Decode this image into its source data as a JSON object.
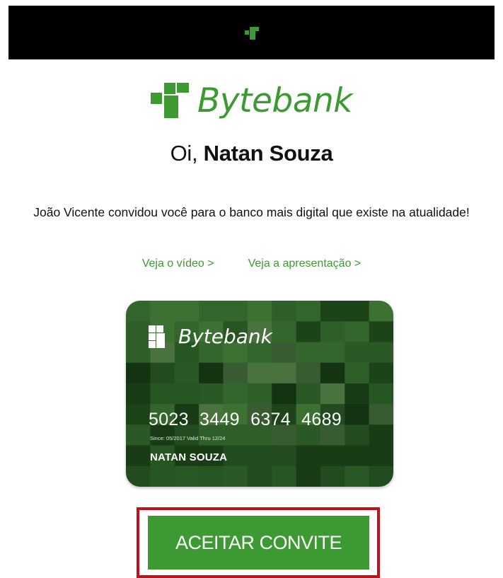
{
  "header": {
    "logo_icon": "bytebank-mark-icon"
  },
  "brand": {
    "name": "Bytebank",
    "color": "#3d9a32"
  },
  "greeting": {
    "prefix": "Oi,",
    "name": "Natan Souza"
  },
  "message": "João Vicente convidou você para o banco mais digital que existe na atualidade!",
  "links": {
    "video": "Veja o vídeo >",
    "presentation": "Veja a apresentação >"
  },
  "card": {
    "brand": "Bytebank",
    "number": "5023 3449 6374 4689",
    "dates": "Since: 05/2017  Valid Thru 12/24",
    "holder": "NATAN SOUZA"
  },
  "cta": {
    "label": "ACEITAR CONVITE",
    "highlight_color": "#c0111a"
  }
}
